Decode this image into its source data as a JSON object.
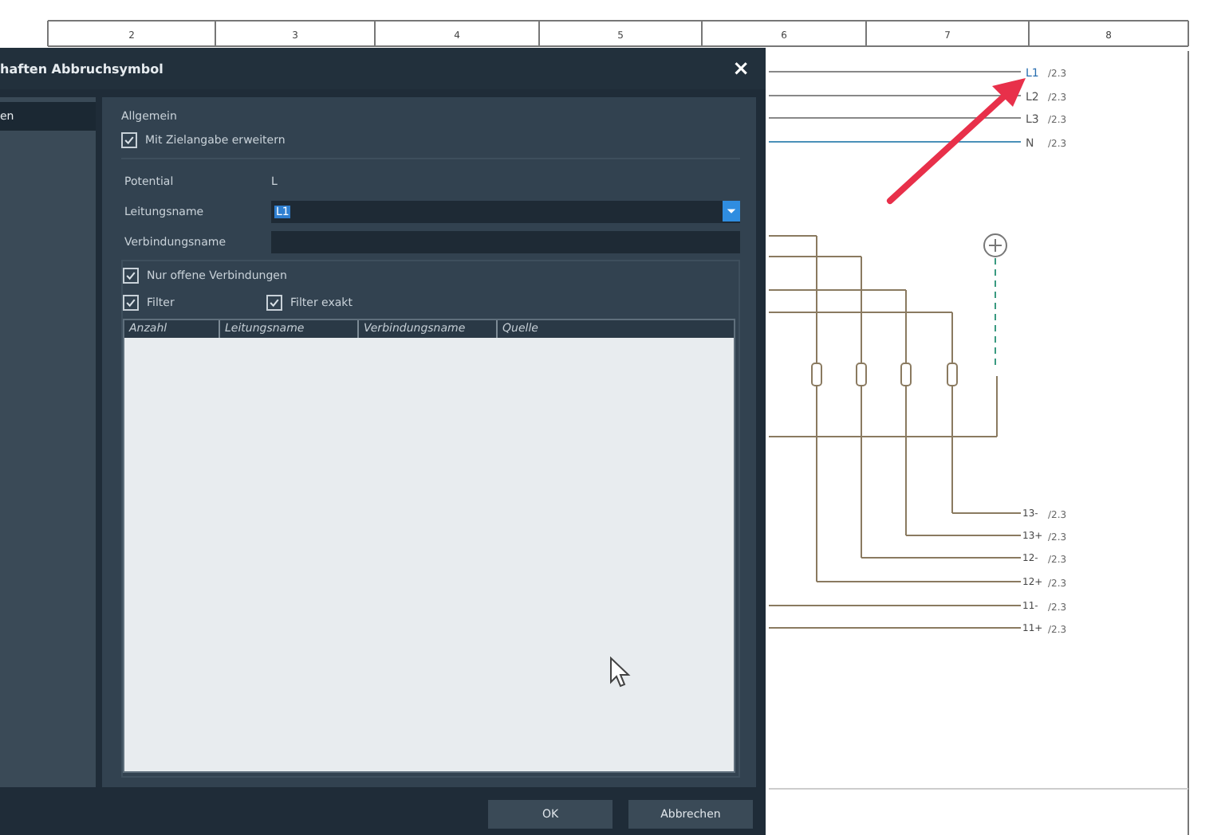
{
  "schematic": {
    "ruler": [
      "2",
      "3",
      "4",
      "5",
      "6",
      "7",
      "8"
    ],
    "top_refs": [
      {
        "name": "L1",
        "ref": "/2.3",
        "color": "#2a6fb0"
      },
      {
        "name": "L2",
        "ref": "/2.3",
        "color": "#555555"
      },
      {
        "name": "L3",
        "ref": "/2.3",
        "color": "#555555"
      },
      {
        "name": "N",
        "ref": "/2.3",
        "color": "#555555"
      }
    ],
    "bottom_refs": [
      {
        "name": "13-",
        "ref": "/2.3"
      },
      {
        "name": "13+",
        "ref": "/2.3"
      },
      {
        "name": "12-",
        "ref": "/2.3"
      },
      {
        "name": "12+",
        "ref": "/2.3"
      },
      {
        "name": "11-",
        "ref": "/2.3"
      },
      {
        "name": "11+",
        "ref": "/2.3"
      }
    ]
  },
  "dialog": {
    "title": "haften Abbruchsymbol",
    "close": "×",
    "nav": [
      {
        "label": "en",
        "selected": true
      }
    ],
    "group_title": "Allgemein",
    "extend": {
      "label": "Mit Zielangabe erweitern",
      "checked": true
    },
    "potential": {
      "label": "Potential",
      "value": "L"
    },
    "line_name": {
      "label": "Leitungsname",
      "value": "L1"
    },
    "connection_name": {
      "label": "Verbindungsname"
    },
    "options": [
      {
        "label": "Nur offene Verbindungen",
        "checked": true
      },
      {
        "label": "Filter",
        "checked": true
      },
      {
        "label": "Filter exakt",
        "checked": true
      }
    ],
    "table": {
      "columns": [
        "Anzahl",
        "Leitungsname",
        "Verbindungsname",
        "Quelle"
      ]
    },
    "buttons": [
      "OK",
      "Abbrechen"
    ]
  }
}
